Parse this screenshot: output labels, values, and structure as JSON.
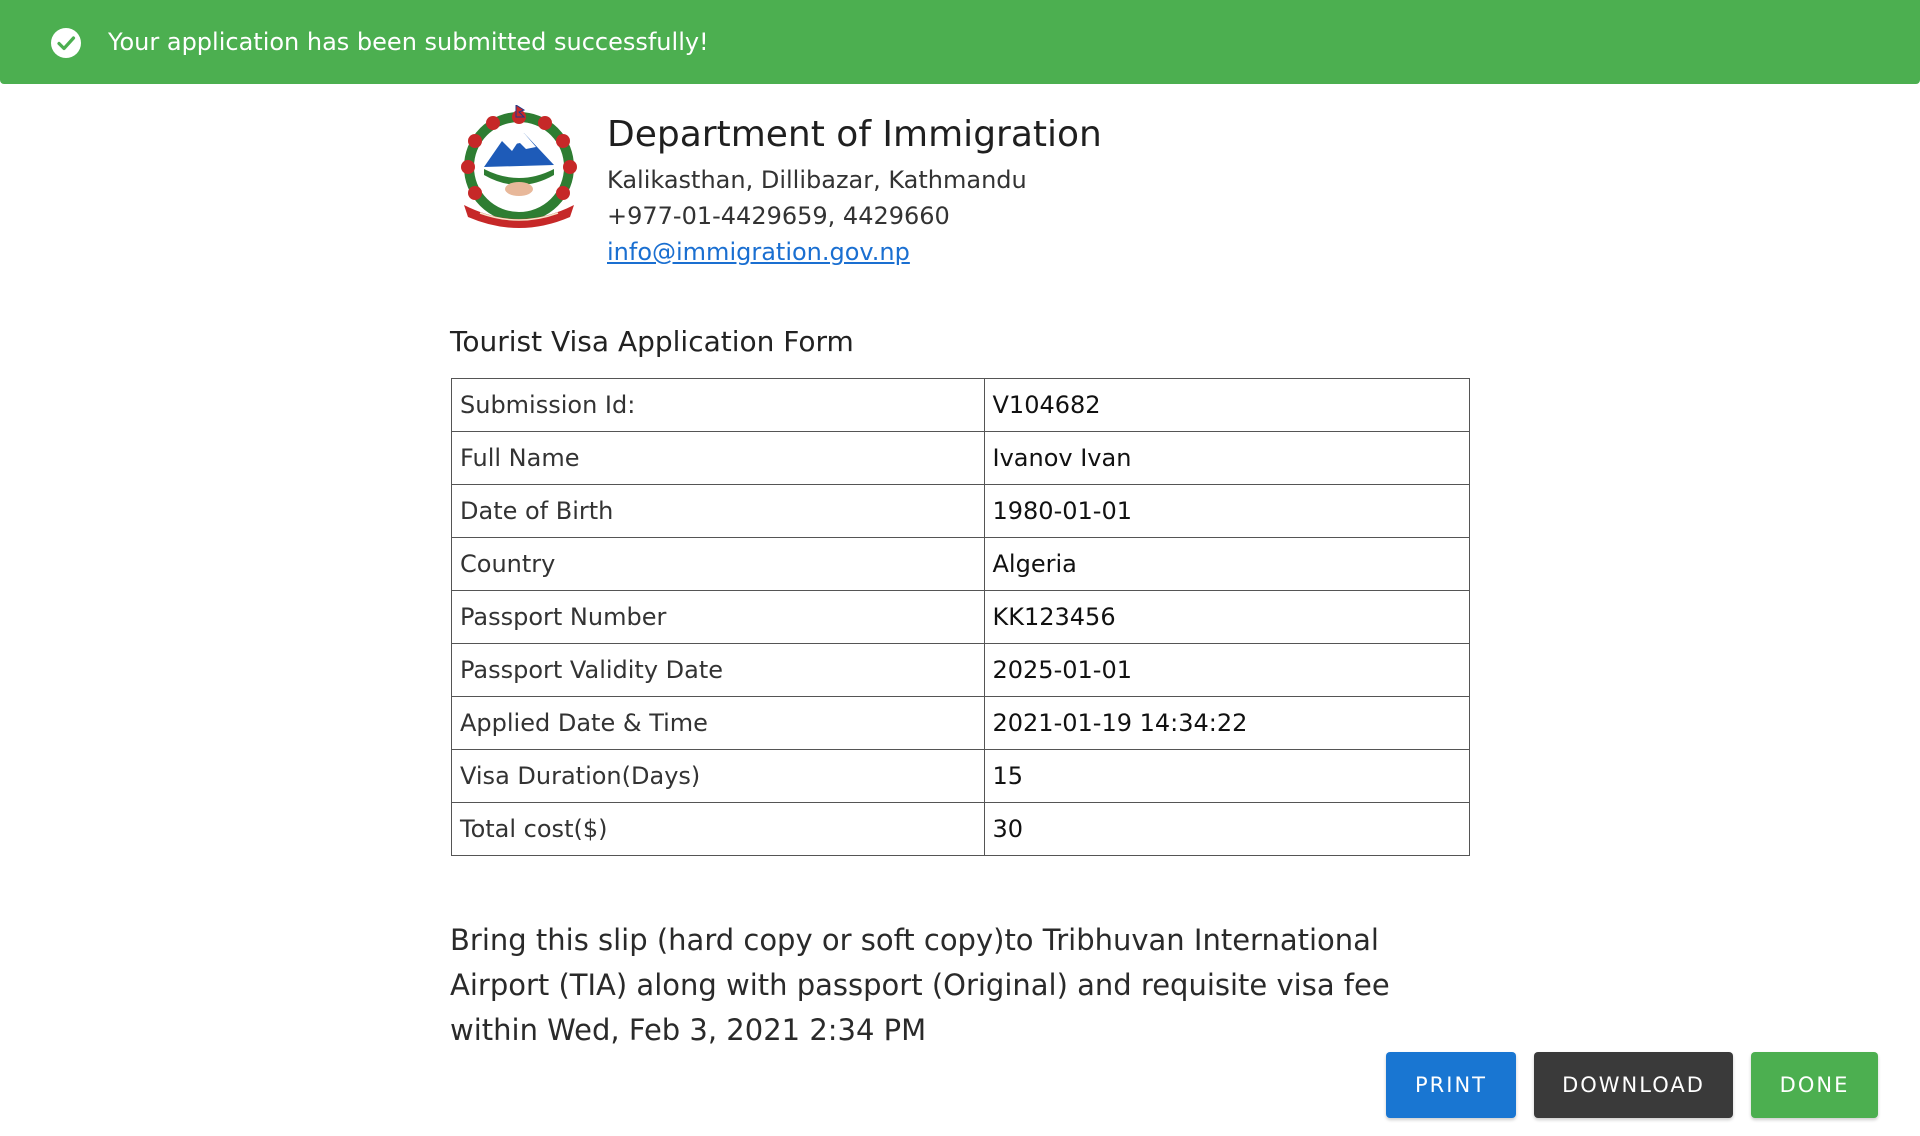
{
  "banner": {
    "message": "Your application has been submitted successfully!",
    "icon": "check-circle-icon",
    "color": "#4caf50"
  },
  "department": {
    "name": "Department of Immigration",
    "address": "Kalikasthan, Dillibazar, Kathmandu",
    "phone": "+977-01-4429659, 4429660",
    "email": "info@immigration.gov.np"
  },
  "form": {
    "title": "Tourist Visa Application Form",
    "rows": [
      {
        "label": "Submission Id:",
        "value": "V104682"
      },
      {
        "label": "Full Name",
        "value": "Ivanov Ivan"
      },
      {
        "label": "Date of Birth",
        "value": "1980-01-01"
      },
      {
        "label": "Country",
        "value": "Algeria"
      },
      {
        "label": "Passport Number",
        "value": "KK123456"
      },
      {
        "label": "Passport Validity Date",
        "value": "2025-01-01"
      },
      {
        "label": "Applied Date & Time",
        "value": "2021-01-19 14:34:22"
      },
      {
        "label": "Visa Duration(Days)",
        "value": "15"
      },
      {
        "label": "Total cost($)",
        "value": "30"
      }
    ]
  },
  "notice": "Bring this slip (hard copy or soft copy)to Tribhuvan International Airport (TIA) along with passport (Original) and requisite visa fee within Wed, Feb 3, 2021 2:34 PM",
  "actions": {
    "print_label": "PRINT",
    "download_label": "DOWNLOAD",
    "done_label": "DONE"
  },
  "colors": {
    "success": "#4caf50",
    "primary": "#1976d2",
    "dark": "#3a3a3a",
    "link": "#1a6fd1"
  }
}
